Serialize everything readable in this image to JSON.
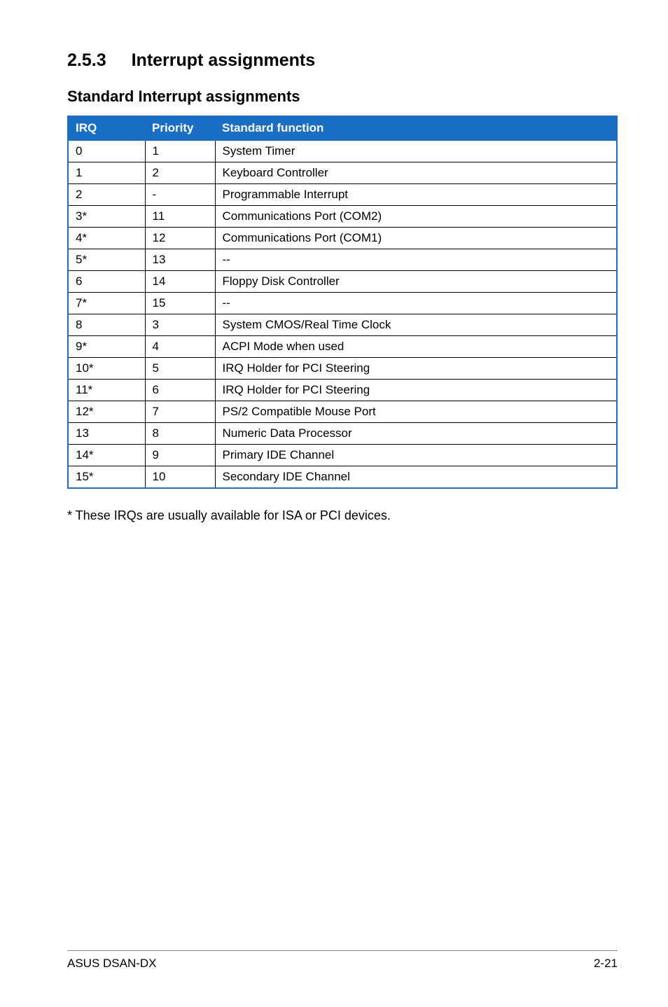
{
  "section": {
    "number": "2.5.3",
    "title": "Interrupt assignments"
  },
  "subheading": "Standard Interrupt assignments",
  "table": {
    "headers": {
      "irq": "IRQ",
      "priority": "Priority",
      "func": "Standard function"
    },
    "rows": [
      {
        "irq": "0",
        "priority": "1",
        "func": "System Timer"
      },
      {
        "irq": "1",
        "priority": "2",
        "func": "Keyboard Controller"
      },
      {
        "irq": "2",
        "priority": "-",
        "func": "Programmable Interrupt"
      },
      {
        "irq": "3*",
        "priority": "11",
        "func": "Communications Port (COM2)"
      },
      {
        "irq": "4*",
        "priority": "12",
        "func": "Communications Port (COM1)"
      },
      {
        "irq": "5*",
        "priority": "13",
        "func": "--"
      },
      {
        "irq": "6",
        "priority": "14",
        "func": "Floppy Disk Controller"
      },
      {
        "irq": "7*",
        "priority": "15",
        "func": "--"
      },
      {
        "irq": "8",
        "priority": "3",
        "func": "System CMOS/Real Time Clock"
      },
      {
        "irq": "9*",
        "priority": "4",
        "func": "ACPI Mode when used"
      },
      {
        "irq": "10*",
        "priority": "5",
        "func": "IRQ Holder for PCI Steering"
      },
      {
        "irq": "11*",
        "priority": "6",
        "func": "IRQ Holder for PCI Steering"
      },
      {
        "irq": "12*",
        "priority": "7",
        "func": "PS/2 Compatible Mouse Port"
      },
      {
        "irq": "13",
        "priority": "8",
        "func": "Numeric Data Processor"
      },
      {
        "irq": "14*",
        "priority": "9",
        "func": "Primary IDE Channel"
      },
      {
        "irq": "15*",
        "priority": "10",
        "func": "Secondary IDE Channel"
      }
    ]
  },
  "footnote": "* These IRQs are usually available for ISA or PCI devices.",
  "footer": {
    "left": "ASUS DSAN-DX",
    "right": "2-21"
  }
}
